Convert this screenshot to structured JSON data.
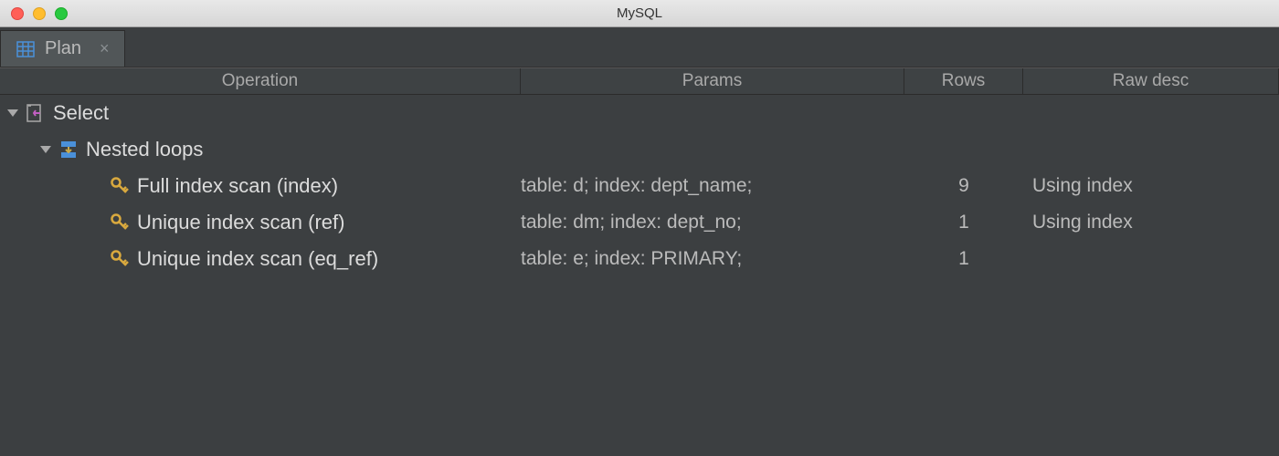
{
  "windowTitle": "MySQL",
  "tab": {
    "label": "Plan"
  },
  "columns": {
    "operation": "Operation",
    "params": "Params",
    "rows": "Rows",
    "raw": "Raw desc"
  },
  "tree": {
    "root": {
      "label": "Select",
      "child": {
        "label": "Nested loops",
        "items": [
          {
            "label": "Full index scan (index)",
            "params": "table: d; index: dept_name;",
            "rows": "9",
            "raw": "Using index"
          },
          {
            "label": "Unique index scan (ref)",
            "params": "table: dm; index: dept_no;",
            "rows": "1",
            "raw": "Using index"
          },
          {
            "label": "Unique index scan (eq_ref)",
            "params": "table: e; index: PRIMARY;",
            "rows": "1",
            "raw": ""
          }
        ]
      }
    }
  }
}
